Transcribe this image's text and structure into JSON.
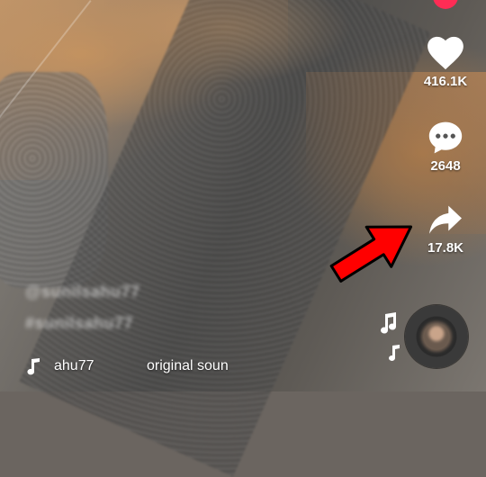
{
  "video": {
    "overlay_handle": "@sunilsahu77",
    "overlay_hashtag": "#sunilsahu77"
  },
  "sidebar": {
    "follow_icon": "plus-icon",
    "like": {
      "icon": "heart-icon",
      "count": "416.1K"
    },
    "comment": {
      "icon": "comment-bubble-icon",
      "count": "2648"
    },
    "share": {
      "icon": "share-arrow-icon",
      "count": "17.8K"
    }
  },
  "sound": {
    "icon": "music-note-icon",
    "name": "ahu77",
    "title": "original soun"
  },
  "colors": {
    "accent": "#fe2c55",
    "annotation_arrow": "#ff0000",
    "icon": "#ffffff"
  }
}
